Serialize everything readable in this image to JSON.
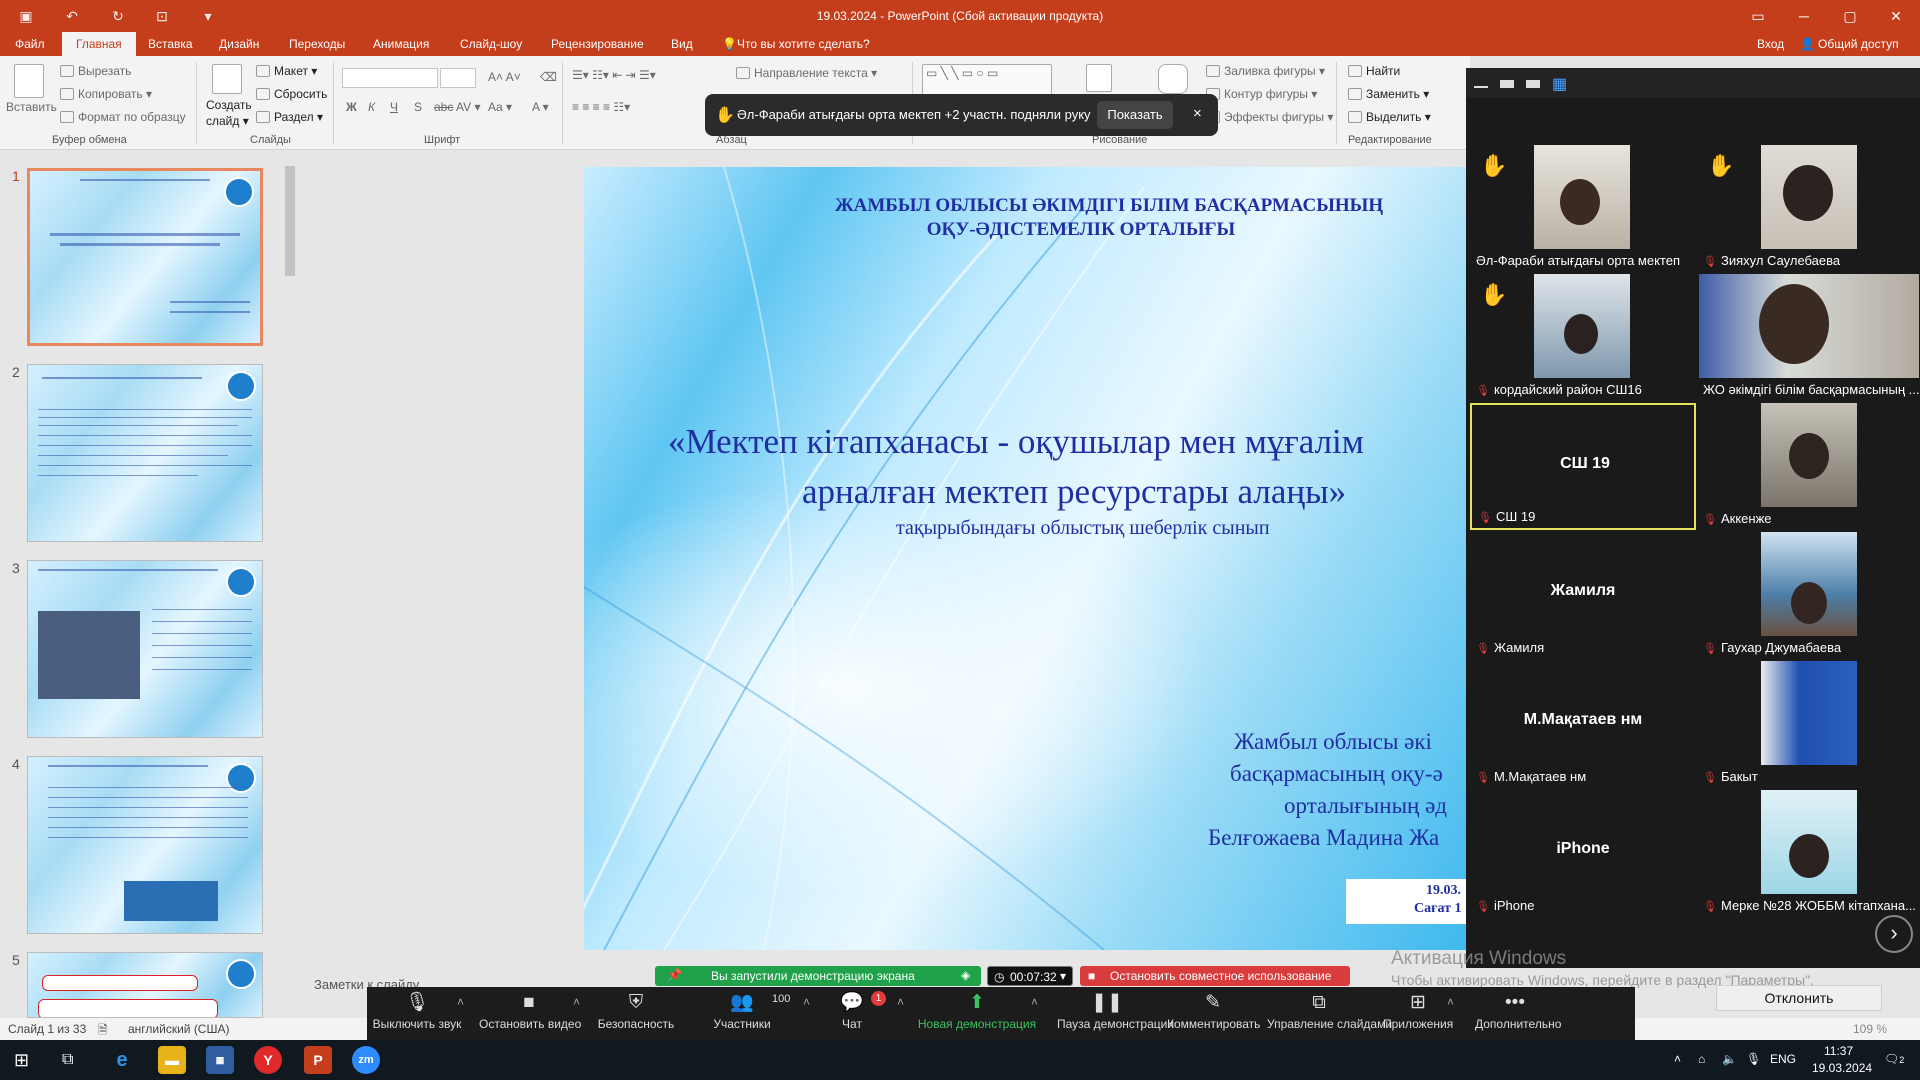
{
  "titlebar": {
    "title": "19.03.2024 - PowerPoint (Сбой активации продукта)"
  },
  "tabs": {
    "file": "Файл",
    "home": "Главная",
    "insert": "Вставка",
    "design": "Дизайн",
    "transitions": "Переходы",
    "animation": "Анимация",
    "slideshow": "Слайд-шоу",
    "review": "Рецензирование",
    "view": "Вид",
    "tell": "Что вы хотите сделать?",
    "signin": "Вход",
    "share": "Общий доступ"
  },
  "ribbon": {
    "paste": "Вставить",
    "cut": "Вырезать",
    "copy": "Копировать",
    "format_painter": "Формат по образцу",
    "clipboard": "Буфер обмена",
    "new_slide_1": "Создать",
    "new_slide_2": "слайд",
    "layout": "Макет",
    "reset": "Сбросить",
    "section": "Раздел",
    "slides": "Слайды",
    "font": "Шрифт",
    "paragraph": "Абзац",
    "text_direction": "Направление текста",
    "drawing": "Рисование",
    "shape_fill": "Заливка фигуры",
    "shape_outline": "Контур фигуры",
    "shape_effects": "Эффекты фигуры",
    "find": "Найти",
    "replace": "Заменить",
    "select": "Выделить",
    "editing": "Редактирование"
  },
  "notification": {
    "message": "Әл-Фараби атығдағы орта мектеп +2 участн. подняли руку",
    "show": "Показать",
    "close": "×"
  },
  "slides_panel": {
    "numbers": [
      "1",
      "2",
      "3",
      "4",
      "5"
    ]
  },
  "slide": {
    "heading_1": "ЖАМБЫЛ ОБЛЫСЫ ӘКІМДІГІ БІЛІМ БАСҚАРМАСЫНЫҢ",
    "heading_2": "ОҚУ-ӘДІСТЕМЕЛІК  ОРТАЛЫҒЫ",
    "title_1": "«Мектеп кітапханасы - оқушылар мен мұғалім",
    "title_2": "арналған мектеп ресурстары алаңы»",
    "subtitle": "тақырыбындағы облыстық  шеберлік сынып",
    "author_1": "Жамбыл облысы әкі",
    "author_2": "басқармасының оқу-ә",
    "author_3": "орталығының әд",
    "author_4": "Белғожаева Мадина Жа",
    "date_1": "19.03.",
    "date_2": "Сағат 1"
  },
  "notes": {
    "label": "Заметки к слайду"
  },
  "status": {
    "slide_of": "Слайд 1 из 33",
    "language": "английский (США)",
    "zoom": "109 %"
  },
  "zoom": {
    "participants": [
      {
        "name": "Әл-Фараби атығдағы орта мектеп",
        "hand": true,
        "video": true,
        "muted": false
      },
      {
        "name": "Зияхул Саулебаева",
        "hand": true,
        "video": true,
        "muted": true
      },
      {
        "name": "кордайский район СШ16",
        "hand": true,
        "video": true,
        "muted": true
      },
      {
        "name": "ЖО әкімдігі білім басқармасының ...",
        "hand": false,
        "video": true,
        "muted": false
      },
      {
        "name": "СШ 19",
        "big": "СШ 19",
        "hand": false,
        "video": false,
        "muted": true
      },
      {
        "name": "Аккенже",
        "hand": false,
        "video": true,
        "muted": true
      },
      {
        "name": "Жамиля",
        "big": "Жамиля",
        "hand": false,
        "video": false,
        "muted": true
      },
      {
        "name": "Гаухар Джумабаева",
        "hand": false,
        "video": true,
        "muted": true
      },
      {
        "name": "М.Мақатаев нм",
        "big": "М.Мақатаев нм",
        "hand": false,
        "video": false,
        "muted": true
      },
      {
        "name": "Бакыт",
        "hand": false,
        "video": true,
        "muted": true
      },
      {
        "name": "iPhone",
        "big": "iPhone",
        "hand": false,
        "video": false,
        "muted": true
      },
      {
        "name": "Мерке №28 ЖОББМ кітапхана...",
        "hand": false,
        "video": true,
        "muted": true
      }
    ],
    "next": "›",
    "watermark_1": "Активация Windows",
    "watermark_2": "Чтобы активировать Windows, перейдите в раздел \"Параметры\".",
    "decline": "Отклонить",
    "share_status": "Вы запустили демонстрацию экрана",
    "timer": "00:07:32",
    "stop_share": "Остановить совместное использование",
    "toolbar": {
      "mute": "Выключить звук",
      "video": "Остановить видео",
      "security": "Безопасность",
      "participants": "Участники",
      "participants_count": "100",
      "chat": "Чат",
      "chat_badge": "1",
      "new_share": "Новая демонстрация",
      "pause": "Пауза демонстрации",
      "annotate": "Комментировать",
      "slides": "Управление слайдами",
      "apps": "Приложения",
      "more": "Дополнительно"
    }
  },
  "taskbar": {
    "lang": "ENG",
    "time": "11:37",
    "date": "19.03.2024",
    "notifications": "2"
  },
  "colors": {
    "ppt_accent": "#c43e1c",
    "slide_text": "#1f2fa2",
    "zoom_bg": "#1a1a1a",
    "zoom_green": "#1fa24a",
    "zoom_red": "#d93c3c"
  }
}
